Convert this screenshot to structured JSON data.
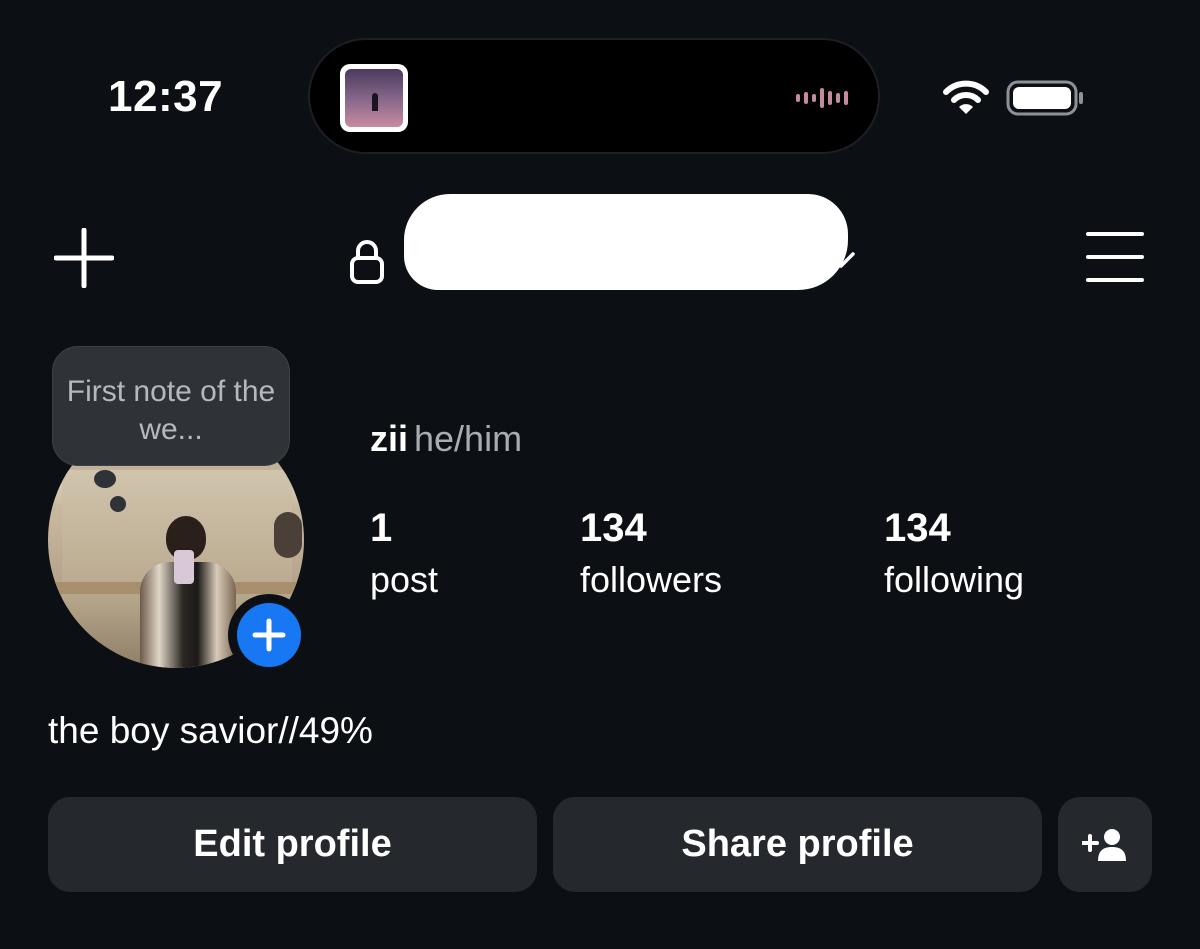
{
  "status_bar": {
    "time": "12:37",
    "icons": [
      "media-thumbnail-icon",
      "audio-waveform-icon",
      "wifi-icon",
      "battery-icon"
    ]
  },
  "header": {
    "left_icon": "plus-icon",
    "lock_icon": "lock-icon",
    "username": "",
    "dropdown_icon": "chevron-down-icon",
    "menu_icon": "hamburger-menu-icon"
  },
  "profile": {
    "note": "First note of the we...",
    "display_name": "zii",
    "pronouns": "he/him",
    "stats": [
      {
        "value": "1",
        "label": "post"
      },
      {
        "value": "134",
        "label": "followers"
      },
      {
        "value": "134",
        "label": "following"
      }
    ],
    "bio": "the boy savior//49%"
  },
  "actions": {
    "edit_label": "Edit profile",
    "share_label": "Share profile",
    "add_user_icon": "add-person-icon"
  },
  "colors": {
    "background": "#0c1014",
    "button": "#25292e",
    "accent": "#1877f2",
    "secondary_text": "#a8adb3"
  }
}
